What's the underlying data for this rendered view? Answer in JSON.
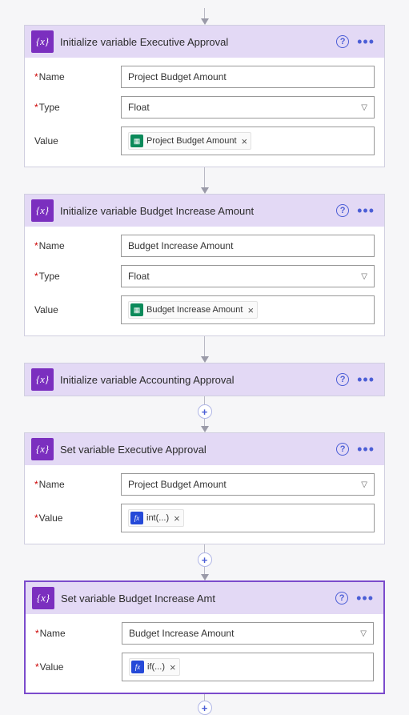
{
  "cards": [
    {
      "title": "Initialize variable Executive Approval",
      "rows": [
        {
          "label": "Name",
          "req": true,
          "type": "text",
          "value": "Project Budget Amount"
        },
        {
          "label": "Type",
          "req": true,
          "type": "select",
          "value": "Float"
        },
        {
          "label": "Value",
          "req": false,
          "type": "token",
          "token_icon": "sp",
          "token_text": "Project Budget Amount"
        }
      ]
    },
    {
      "title": "Initialize variable Budget Increase Amount",
      "rows": [
        {
          "label": "Name",
          "req": true,
          "type": "text",
          "value": "Budget Increase Amount"
        },
        {
          "label": "Type",
          "req": true,
          "type": "select",
          "value": "Float"
        },
        {
          "label": "Value",
          "req": false,
          "type": "token",
          "token_icon": "sp",
          "token_text": "Budget Increase Amount"
        }
      ]
    },
    {
      "title": "Initialize variable Accounting Approval",
      "collapsed": true
    },
    {
      "title": "Set variable Executive Approval",
      "rows": [
        {
          "label": "Name",
          "req": true,
          "type": "select",
          "value": "Project Budget Amount"
        },
        {
          "label": "Value",
          "req": true,
          "type": "token",
          "token_icon": "fx",
          "token_text": "int(...)"
        }
      ]
    },
    {
      "title": "Set variable Budget Increase Amt",
      "selected": true,
      "rows": [
        {
          "label": "Name",
          "req": true,
          "type": "select",
          "value": "Budget Increase Amount"
        },
        {
          "label": "Value",
          "req": true,
          "type": "token",
          "token_icon": "fx",
          "token_text": "if(...)"
        }
      ]
    }
  ]
}
